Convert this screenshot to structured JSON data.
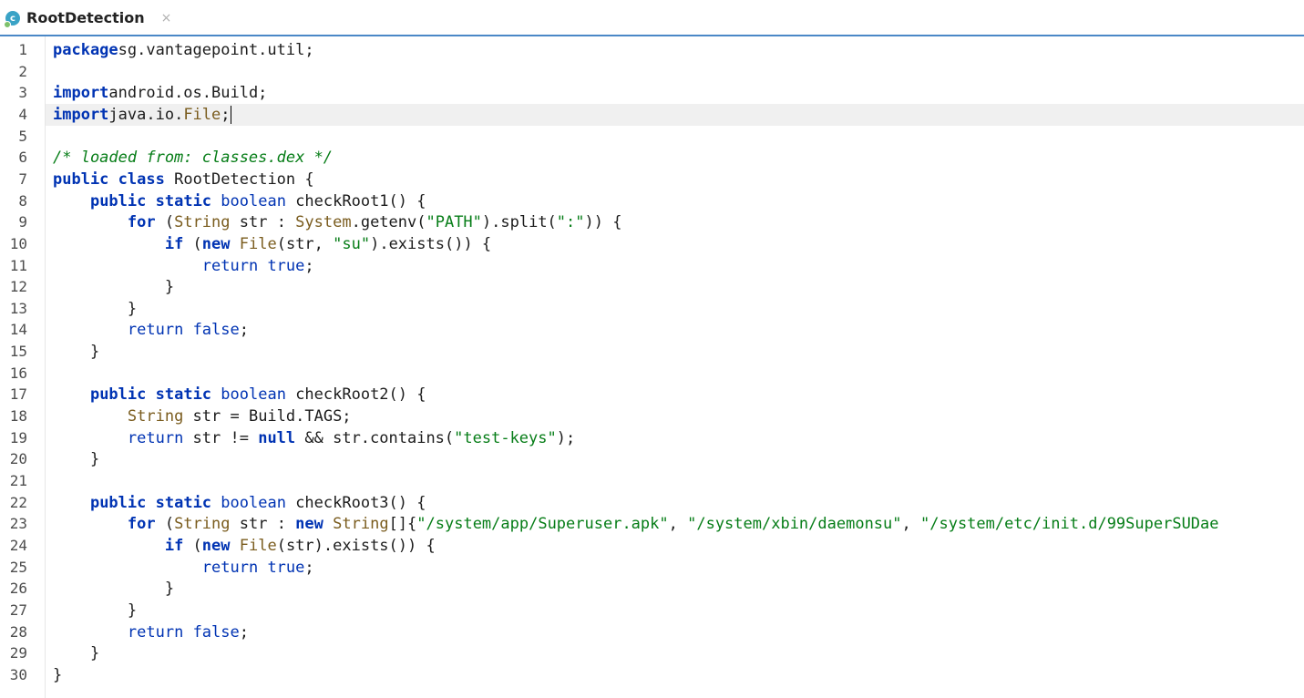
{
  "tab": {
    "title": "RootDetection",
    "icon": "class-icon",
    "icon_letter": "c",
    "close_glyph": "×"
  },
  "colors": {
    "keyword": "#0033b3",
    "string": "#067d17",
    "type": "#7a5c1e",
    "tab_underline": "#4a88c7",
    "current_line": "#f0f0f0"
  },
  "editor": {
    "current_line": 4,
    "lines": [
      [
        [
          "kw",
          "package"
        ],
        [
          "",
          "sg.vantagepoint.util;"
        ]
      ],
      [],
      [
        [
          "kw",
          "import"
        ],
        [
          "",
          "android.os.Build;"
        ]
      ],
      [
        [
          "kw",
          "import"
        ],
        [
          "",
          "java.io."
        ],
        [
          "type",
          "File"
        ],
        [
          "",
          ";"
        ]
      ],
      [],
      [
        [
          "cm",
          "/* loaded from: classes.dex */"
        ]
      ],
      [
        [
          "kw",
          "public"
        ],
        [
          "",
          " "
        ],
        [
          "kw",
          "class"
        ],
        [
          "",
          " RootDetection {"
        ]
      ],
      [
        [
          "",
          "    "
        ],
        [
          "kw",
          "public"
        ],
        [
          "",
          " "
        ],
        [
          "kw",
          "static"
        ],
        [
          "",
          " "
        ],
        [
          "kw2",
          "boolean"
        ],
        [
          "",
          " checkRoot1() {"
        ]
      ],
      [
        [
          "",
          "        "
        ],
        [
          "kw",
          "for"
        ],
        [
          "",
          " ("
        ],
        [
          "type",
          "String"
        ],
        [
          "",
          " str : "
        ],
        [
          "type",
          "System"
        ],
        [
          "",
          ".getenv("
        ],
        [
          "str",
          "\"PATH\""
        ],
        [
          "",
          ").split("
        ],
        [
          "str",
          "\":\""
        ],
        [
          "",
          "))"
        ],
        [
          "",
          " {"
        ]
      ],
      [
        [
          "",
          "            "
        ],
        [
          "kw",
          "if"
        ],
        [
          "",
          " ("
        ],
        [
          "kw",
          "new"
        ],
        [
          "",
          " "
        ],
        [
          "type",
          "File"
        ],
        [
          "",
          "(str, "
        ],
        [
          "str",
          "\"su\""
        ],
        [
          "",
          ").exists()) {"
        ]
      ],
      [
        [
          "",
          "                "
        ],
        [
          "kw2",
          "return"
        ],
        [
          "",
          " "
        ],
        [
          "kw2",
          "true"
        ],
        [
          "",
          ";"
        ]
      ],
      [
        [
          "",
          "            }"
        ]
      ],
      [
        [
          "",
          "        }"
        ]
      ],
      [
        [
          "",
          "        "
        ],
        [
          "kw2",
          "return"
        ],
        [
          "",
          " "
        ],
        [
          "kw2",
          "false"
        ],
        [
          "",
          ";"
        ]
      ],
      [
        [
          "",
          "    }"
        ]
      ],
      [],
      [
        [
          "",
          "    "
        ],
        [
          "kw",
          "public"
        ],
        [
          "",
          " "
        ],
        [
          "kw",
          "static"
        ],
        [
          "",
          " "
        ],
        [
          "kw2",
          "boolean"
        ],
        [
          "",
          " checkRoot2() {"
        ]
      ],
      [
        [
          "",
          "        "
        ],
        [
          "type",
          "String"
        ],
        [
          "",
          " str = Build.TAGS;"
        ]
      ],
      [
        [
          "",
          "        "
        ],
        [
          "kw2",
          "return"
        ],
        [
          "",
          " str != "
        ],
        [
          "kw",
          "null"
        ],
        [
          "",
          " && str.contains("
        ],
        [
          "str",
          "\"test-keys\""
        ],
        [
          "",
          ");"
        ]
      ],
      [
        [
          "",
          "    }"
        ]
      ],
      [],
      [
        [
          "",
          "    "
        ],
        [
          "kw",
          "public"
        ],
        [
          "",
          " "
        ],
        [
          "kw",
          "static"
        ],
        [
          "",
          " "
        ],
        [
          "kw2",
          "boolean"
        ],
        [
          "",
          " checkRoot3() {"
        ]
      ],
      [
        [
          "",
          "        "
        ],
        [
          "kw",
          "for"
        ],
        [
          "",
          " ("
        ],
        [
          "type",
          "String"
        ],
        [
          "",
          " str : "
        ],
        [
          "kw",
          "new"
        ],
        [
          "",
          " "
        ],
        [
          "type",
          "String"
        ],
        [
          "",
          "[]{"
        ],
        [
          "str",
          "\"/system/app/Superuser.apk\""
        ],
        [
          "",
          ", "
        ],
        [
          "str",
          "\"/system/xbin/daemonsu\""
        ],
        [
          "",
          ", "
        ],
        [
          "str",
          "\"/system/etc/init.d/99SuperSUDae"
        ]
      ],
      [
        [
          "",
          "            "
        ],
        [
          "kw",
          "if"
        ],
        [
          "",
          " ("
        ],
        [
          "kw",
          "new"
        ],
        [
          "",
          " "
        ],
        [
          "type",
          "File"
        ],
        [
          "",
          "(str).exists()) {"
        ]
      ],
      [
        [
          "",
          "                "
        ],
        [
          "kw2",
          "return"
        ],
        [
          "",
          " "
        ],
        [
          "kw2",
          "true"
        ],
        [
          "",
          ";"
        ]
      ],
      [
        [
          "",
          "            }"
        ]
      ],
      [
        [
          "",
          "        }"
        ]
      ],
      [
        [
          "",
          "        "
        ],
        [
          "kw2",
          "return"
        ],
        [
          "",
          " "
        ],
        [
          "kw2",
          "false"
        ],
        [
          "",
          ";"
        ]
      ],
      [
        [
          "",
          "    }"
        ]
      ],
      [
        [
          "",
          "}"
        ]
      ]
    ]
  }
}
